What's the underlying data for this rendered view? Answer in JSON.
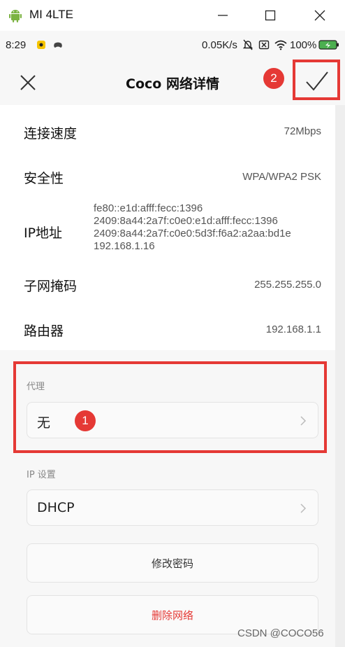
{
  "window": {
    "title": "MI 4LTE"
  },
  "statusbar": {
    "time": "8:29",
    "net_speed": "0.05K/s",
    "battery": "100%"
  },
  "header": {
    "title": "Coco  网络详情"
  },
  "details": [
    {
      "label": "连接速度",
      "value": "72Mbps"
    },
    {
      "label": "安全性",
      "value": "WPA/WPA2 PSK"
    },
    {
      "label": "IP地址",
      "values": [
        "fe80::e1d:afff:fecc:1396",
        "2409:8a44:2a7f:c0e0:e1d:afff:fecc:1396",
        "2409:8a44:2a7f:c0e0:5d3f:f6a2:a2aa:bd1e",
        "192.168.1.16"
      ]
    },
    {
      "label": "子网掩码",
      "value": "255.255.255.0"
    },
    {
      "label": "路由器",
      "value": "192.168.1.1"
    }
  ],
  "proxy": {
    "label": "代理",
    "value": "无"
  },
  "ip_settings": {
    "label": "IP 设置",
    "value": "DHCP"
  },
  "actions": {
    "modify_password": "修改密码",
    "delete_network": "删除网络"
  },
  "annotations": {
    "badge_1": "1",
    "badge_2": "2",
    "color": "#e53935"
  },
  "watermark": "CSDN @COCO56"
}
